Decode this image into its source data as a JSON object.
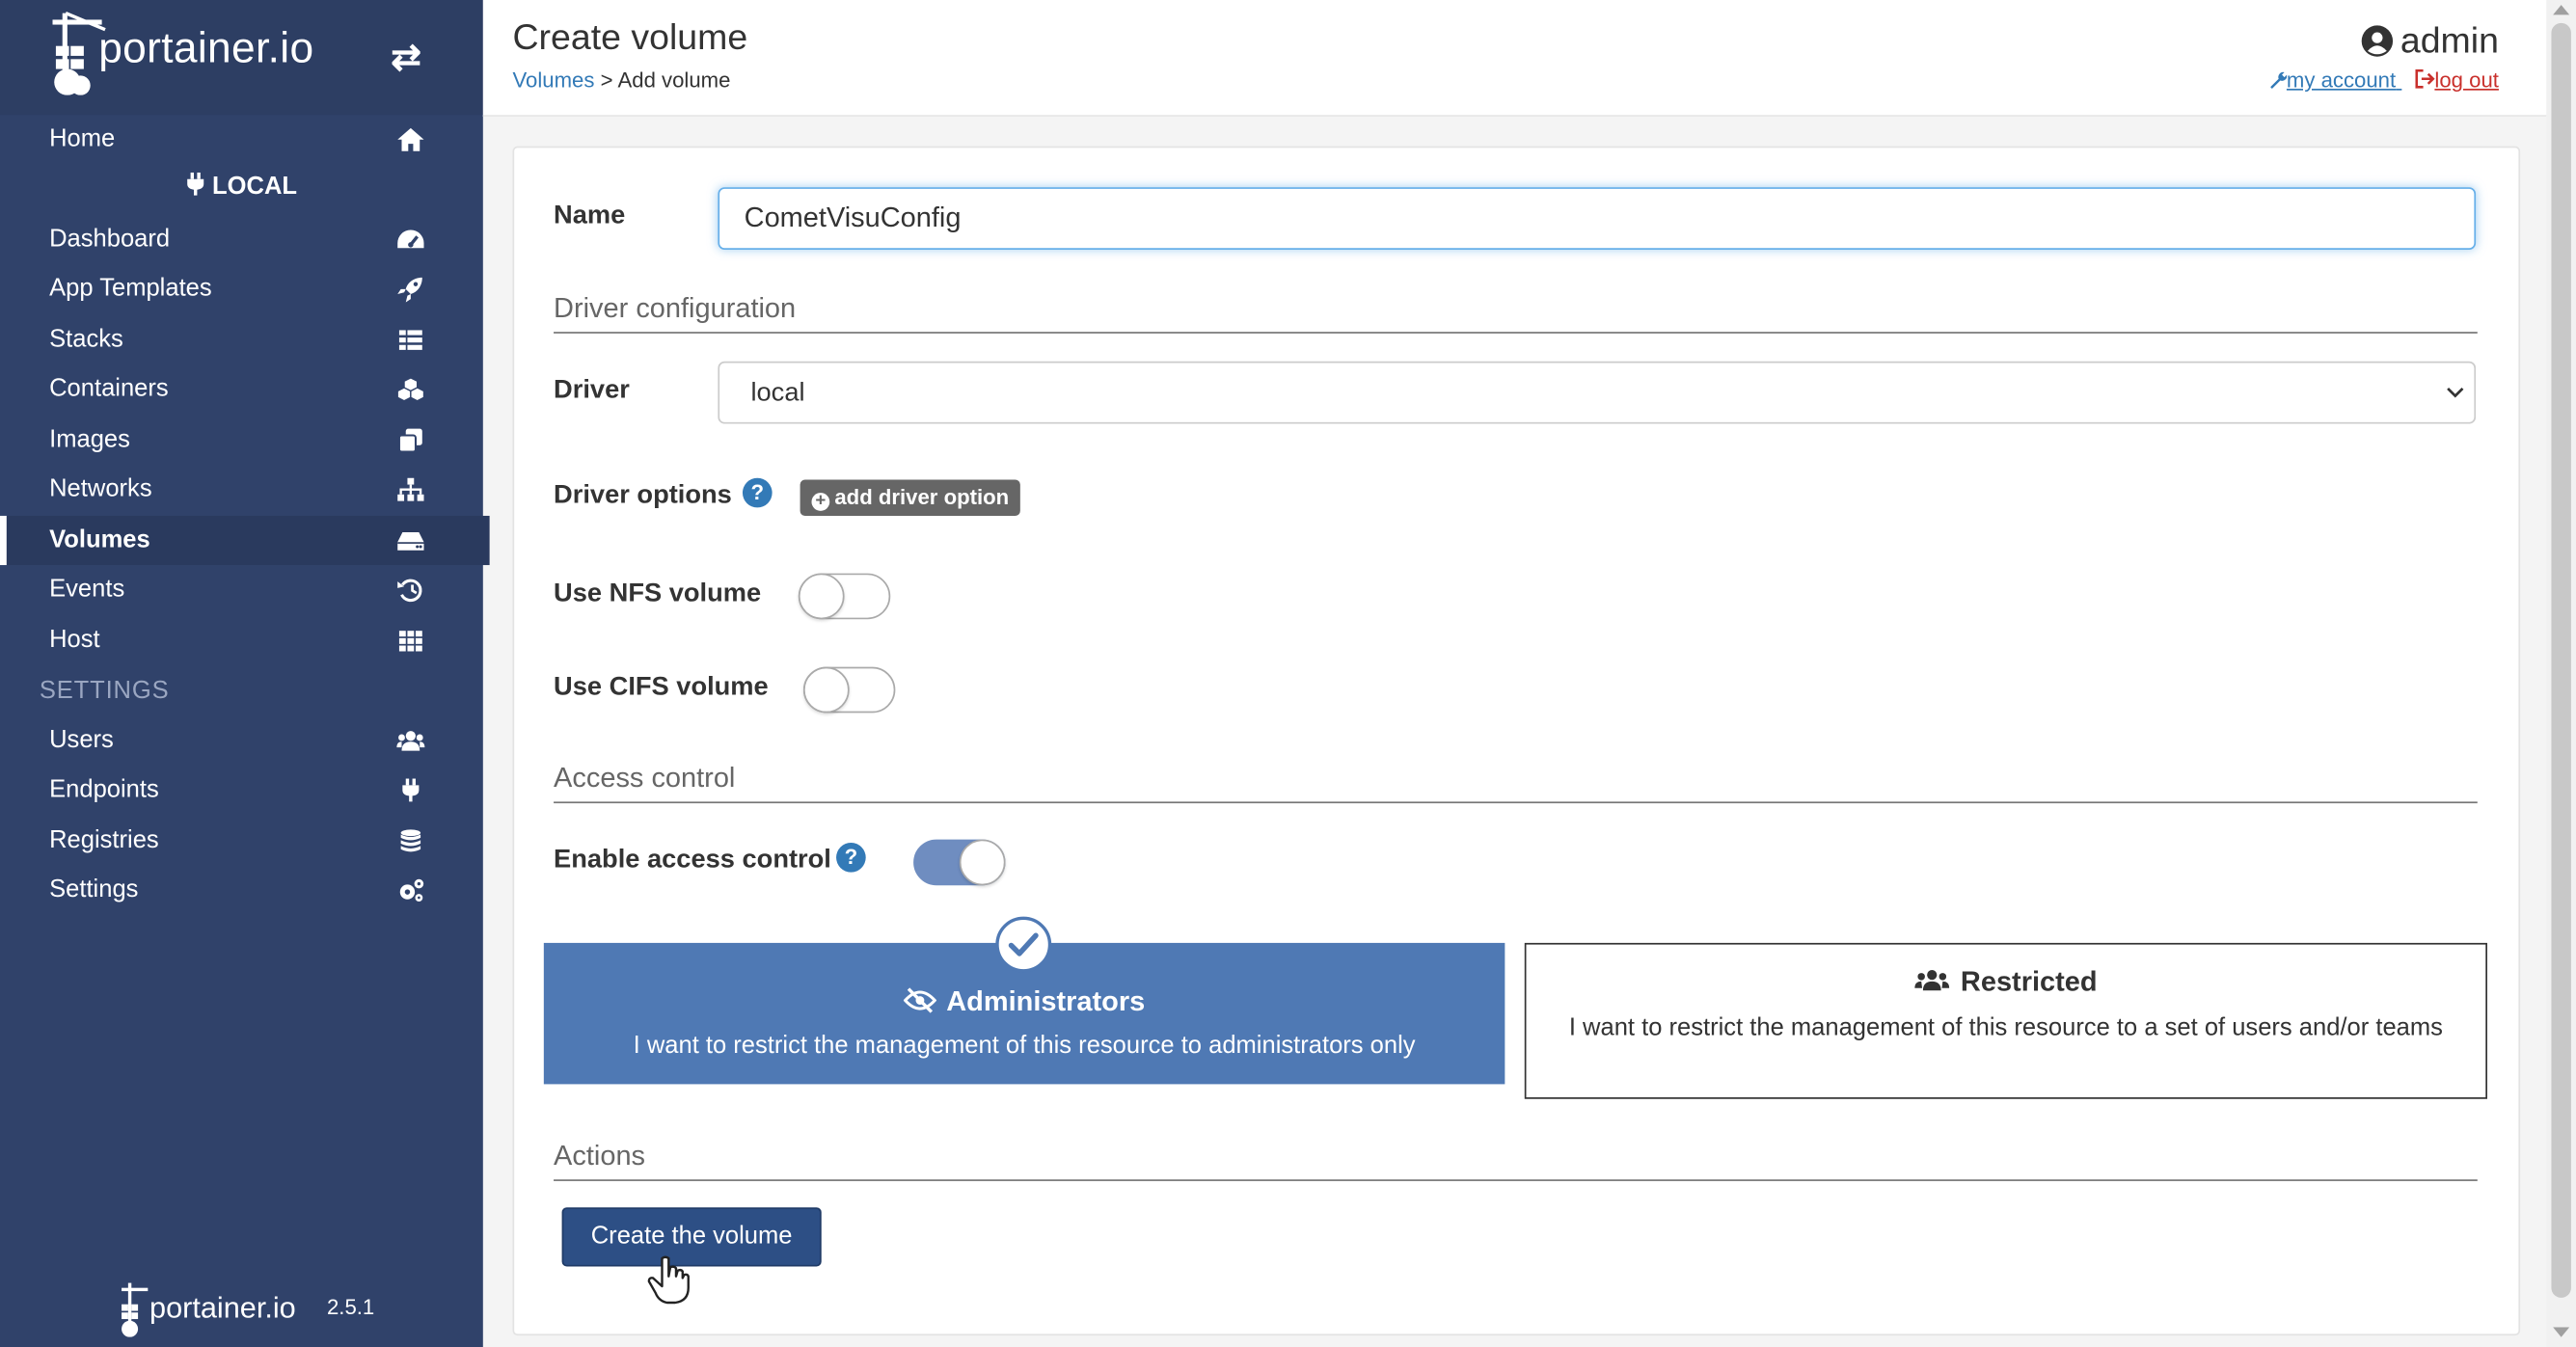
{
  "sidebar": {
    "brand": "portainer.io",
    "toggle_glyph": "⇄",
    "home": {
      "label": "Home",
      "icon": "home-icon"
    },
    "endpoint_header": "LOCAL",
    "items": [
      {
        "label": "Dashboard",
        "icon": "tachometer-icon"
      },
      {
        "label": "App Templates",
        "icon": "rocket-icon"
      },
      {
        "label": "Stacks",
        "icon": "list-icon"
      },
      {
        "label": "Containers",
        "icon": "cubes-icon"
      },
      {
        "label": "Images",
        "icon": "clone-icon"
      },
      {
        "label": "Networks",
        "icon": "sitemap-icon"
      },
      {
        "label": "Volumes",
        "icon": "hdd-icon",
        "active": true
      },
      {
        "label": "Events",
        "icon": "history-icon"
      },
      {
        "label": "Host",
        "icon": "grid-icon"
      }
    ],
    "settings_header": "SETTINGS",
    "settings_items": [
      {
        "label": "Users",
        "icon": "users-icon"
      },
      {
        "label": "Endpoints",
        "icon": "plug-icon"
      },
      {
        "label": "Registries",
        "icon": "database-icon"
      },
      {
        "label": "Settings",
        "icon": "cogs-icon"
      }
    ],
    "footer": {
      "brand": "portainer.io",
      "version": "2.5.1"
    }
  },
  "header": {
    "title": "Create volume",
    "breadcrumb": {
      "link": "Volumes",
      "separator": ">",
      "current": "Add volume"
    },
    "user": "admin",
    "my_account": "my account",
    "log_out": "log out"
  },
  "form": {
    "name_label": "Name",
    "name_value": "CometVisuConfig",
    "driver_section": "Driver configuration",
    "driver_label": "Driver",
    "driver_value": "local",
    "driver_options_label": "Driver options",
    "help_glyph": "?",
    "add_driver_option": "add driver option",
    "nfs_label": "Use NFS volume",
    "nfs_enabled": false,
    "cifs_label": "Use CIFS volume",
    "cifs_enabled": false,
    "access_section": "Access control",
    "access_label": "Enable access control",
    "access_enabled": true,
    "options": [
      {
        "title": "Administrators",
        "desc": "I want to restrict the management of this resource to administrators only",
        "selected": true,
        "icon": "eye-slash-icon"
      },
      {
        "title": "Restricted",
        "desc": "I want to restrict the management of this resource to a set of users and/or teams",
        "selected": false,
        "icon": "users-icon"
      }
    ],
    "actions_section": "Actions",
    "create_button": "Create the volume"
  },
  "colors": {
    "sidebar_bg": "#30426a",
    "accent": "#4f79b4",
    "primary_button": "#2d4f85",
    "link": "#337ab7",
    "danger_link": "#c9302c"
  }
}
